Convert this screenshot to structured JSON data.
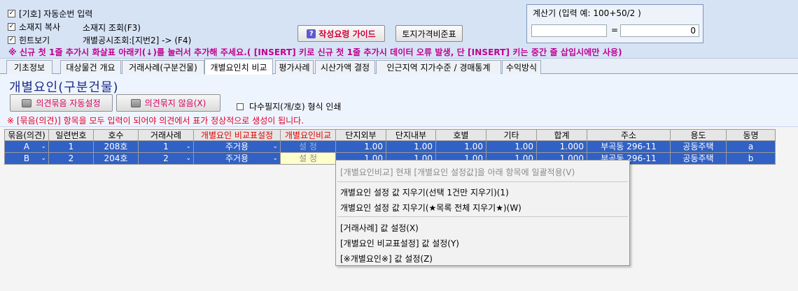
{
  "top": {
    "cut_text": "...",
    "checks": [
      {
        "label": "[기호] 자동순번 입력",
        "checked": true
      },
      {
        "label": "소재지 복사",
        "checked": true
      },
      {
        "label": "힌트보기",
        "checked": true
      }
    ],
    "info1": "소재지 조회(F3)",
    "info2": "개별공시조회:[지번2] -> (F4)",
    "guide_label": "작성요령 가이드",
    "land_label": "토지가격비준표",
    "warning": "※ 신규 첫 1줄 추가시 화살표 아래키(↓)를 눌러서 추가해 주세요.( [INSERT] 키로 신규 첫 1줄 추가시 데이터 오류 발생, 단 [INSERT] 키는 중간 줄 삽입시에만 사용)"
  },
  "calc": {
    "title": "계산기  (입력 예: 100+50/2 )",
    "input": "",
    "eq": "=",
    "result": "0"
  },
  "tabs": [
    "기초정보",
    "대상물건 개요",
    "거래사례(구분건물)",
    "개별요인치 비교",
    "평가사례",
    "시산가액 결정",
    "인근지역 지가수준 / 경매통계",
    "수익방식"
  ],
  "active_tab": 3,
  "panel": {
    "title": "개별요인(구분건물)",
    "btn_auto": "의견묶음 자동설정",
    "btn_none": "의견묶지 않음(X)",
    "print_label": "다수필지(개/호) 형식 인쇄",
    "note": "※ [묶음(의견)] 항목을 모두 입력이 되어야 의견에서 표가 정상적으로 생성이 됩니다."
  },
  "grid": {
    "headers": [
      "묶음(의견)",
      "일련번호",
      "호수",
      "거래사례",
      "개별요인 비교표설정",
      "개별요인비교",
      "단지외부",
      "단지내부",
      "호별",
      "기타",
      "합계",
      "주소",
      "용도",
      "동명"
    ],
    "rows": [
      [
        "A",
        "1",
        "208호",
        "1",
        "주거용",
        "설 정",
        "1.00",
        "1.00",
        "1.00",
        "1.00",
        "1.000",
        "부곡동 296-11",
        "공동주택",
        "a"
      ],
      [
        "B",
        "2",
        "204호",
        "2",
        "주거용",
        "설 정",
        "1.00",
        "1.00",
        "1.00",
        "1.00",
        "1.000",
        "부곡동 296-11",
        "공동주택",
        "b"
      ]
    ]
  },
  "context_menu": {
    "items": [
      "[개별요인비교] 현재 [개별요인 설정값]을 아래 항목에 일괄적용(V)",
      "개별요인 설정 값 지우기(선택 1건만 지우기)(1)",
      "개별요인 설정 값 지우기(★목록 전체 지우기★)(W)",
      "[거래사례] 값 설정(X)",
      "[개별요인 비교표설정] 값 설정(Y)",
      "[※개별요인※] 값 설정(Z)"
    ]
  }
}
